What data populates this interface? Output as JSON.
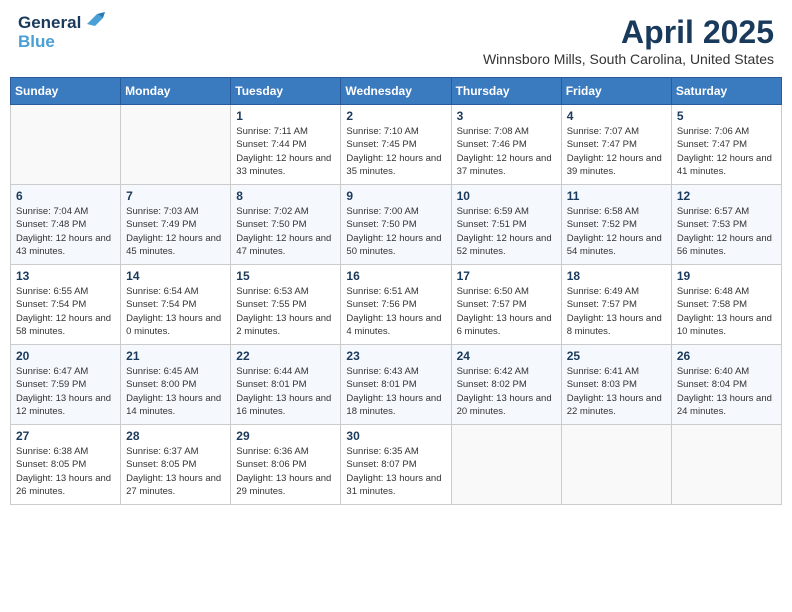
{
  "header": {
    "logo_line1": "General",
    "logo_line2": "Blue",
    "month": "April 2025",
    "location": "Winnsboro Mills, South Carolina, United States"
  },
  "weekdays": [
    "Sunday",
    "Monday",
    "Tuesday",
    "Wednesday",
    "Thursday",
    "Friday",
    "Saturday"
  ],
  "weeks": [
    [
      {
        "day": "",
        "info": ""
      },
      {
        "day": "",
        "info": ""
      },
      {
        "day": "1",
        "info": "Sunrise: 7:11 AM\nSunset: 7:44 PM\nDaylight: 12 hours\nand 33 minutes."
      },
      {
        "day": "2",
        "info": "Sunrise: 7:10 AM\nSunset: 7:45 PM\nDaylight: 12 hours\nand 35 minutes."
      },
      {
        "day": "3",
        "info": "Sunrise: 7:08 AM\nSunset: 7:46 PM\nDaylight: 12 hours\nand 37 minutes."
      },
      {
        "day": "4",
        "info": "Sunrise: 7:07 AM\nSunset: 7:47 PM\nDaylight: 12 hours\nand 39 minutes."
      },
      {
        "day": "5",
        "info": "Sunrise: 7:06 AM\nSunset: 7:47 PM\nDaylight: 12 hours\nand 41 minutes."
      }
    ],
    [
      {
        "day": "6",
        "info": "Sunrise: 7:04 AM\nSunset: 7:48 PM\nDaylight: 12 hours\nand 43 minutes."
      },
      {
        "day": "7",
        "info": "Sunrise: 7:03 AM\nSunset: 7:49 PM\nDaylight: 12 hours\nand 45 minutes."
      },
      {
        "day": "8",
        "info": "Sunrise: 7:02 AM\nSunset: 7:50 PM\nDaylight: 12 hours\nand 47 minutes."
      },
      {
        "day": "9",
        "info": "Sunrise: 7:00 AM\nSunset: 7:50 PM\nDaylight: 12 hours\nand 50 minutes."
      },
      {
        "day": "10",
        "info": "Sunrise: 6:59 AM\nSunset: 7:51 PM\nDaylight: 12 hours\nand 52 minutes."
      },
      {
        "day": "11",
        "info": "Sunrise: 6:58 AM\nSunset: 7:52 PM\nDaylight: 12 hours\nand 54 minutes."
      },
      {
        "day": "12",
        "info": "Sunrise: 6:57 AM\nSunset: 7:53 PM\nDaylight: 12 hours\nand 56 minutes."
      }
    ],
    [
      {
        "day": "13",
        "info": "Sunrise: 6:55 AM\nSunset: 7:54 PM\nDaylight: 12 hours\nand 58 minutes."
      },
      {
        "day": "14",
        "info": "Sunrise: 6:54 AM\nSunset: 7:54 PM\nDaylight: 13 hours\nand 0 minutes."
      },
      {
        "day": "15",
        "info": "Sunrise: 6:53 AM\nSunset: 7:55 PM\nDaylight: 13 hours\nand 2 minutes."
      },
      {
        "day": "16",
        "info": "Sunrise: 6:51 AM\nSunset: 7:56 PM\nDaylight: 13 hours\nand 4 minutes."
      },
      {
        "day": "17",
        "info": "Sunrise: 6:50 AM\nSunset: 7:57 PM\nDaylight: 13 hours\nand 6 minutes."
      },
      {
        "day": "18",
        "info": "Sunrise: 6:49 AM\nSunset: 7:57 PM\nDaylight: 13 hours\nand 8 minutes."
      },
      {
        "day": "19",
        "info": "Sunrise: 6:48 AM\nSunset: 7:58 PM\nDaylight: 13 hours\nand 10 minutes."
      }
    ],
    [
      {
        "day": "20",
        "info": "Sunrise: 6:47 AM\nSunset: 7:59 PM\nDaylight: 13 hours\nand 12 minutes."
      },
      {
        "day": "21",
        "info": "Sunrise: 6:45 AM\nSunset: 8:00 PM\nDaylight: 13 hours\nand 14 minutes."
      },
      {
        "day": "22",
        "info": "Sunrise: 6:44 AM\nSunset: 8:01 PM\nDaylight: 13 hours\nand 16 minutes."
      },
      {
        "day": "23",
        "info": "Sunrise: 6:43 AM\nSunset: 8:01 PM\nDaylight: 13 hours\nand 18 minutes."
      },
      {
        "day": "24",
        "info": "Sunrise: 6:42 AM\nSunset: 8:02 PM\nDaylight: 13 hours\nand 20 minutes."
      },
      {
        "day": "25",
        "info": "Sunrise: 6:41 AM\nSunset: 8:03 PM\nDaylight: 13 hours\nand 22 minutes."
      },
      {
        "day": "26",
        "info": "Sunrise: 6:40 AM\nSunset: 8:04 PM\nDaylight: 13 hours\nand 24 minutes."
      }
    ],
    [
      {
        "day": "27",
        "info": "Sunrise: 6:38 AM\nSunset: 8:05 PM\nDaylight: 13 hours\nand 26 minutes."
      },
      {
        "day": "28",
        "info": "Sunrise: 6:37 AM\nSunset: 8:05 PM\nDaylight: 13 hours\nand 27 minutes."
      },
      {
        "day": "29",
        "info": "Sunrise: 6:36 AM\nSunset: 8:06 PM\nDaylight: 13 hours\nand 29 minutes."
      },
      {
        "day": "30",
        "info": "Sunrise: 6:35 AM\nSunset: 8:07 PM\nDaylight: 13 hours\nand 31 minutes."
      },
      {
        "day": "",
        "info": ""
      },
      {
        "day": "",
        "info": ""
      },
      {
        "day": "",
        "info": ""
      }
    ]
  ]
}
